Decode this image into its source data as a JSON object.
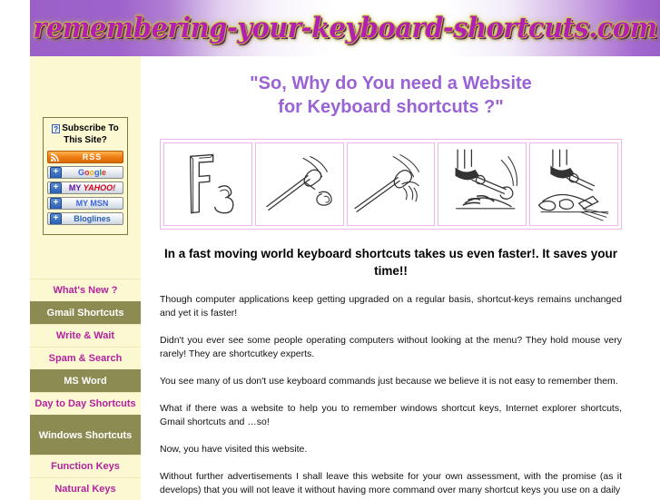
{
  "banner": {
    "title": "remembering-your-keyboard-shortcuts.com"
  },
  "sidebar": {
    "subscribe": {
      "icon": "question-mark-icon",
      "icon_glyph": "?",
      "heading_line1": "Subscribe To",
      "heading_line2": "This Site?",
      "buttons": [
        {
          "name": "rss",
          "label": "RSS",
          "icon": "rss-icon"
        },
        {
          "name": "google",
          "label": "Google",
          "icon": "plus-icon"
        },
        {
          "name": "my-yahoo",
          "label_prefix": "MY ",
          "label": "YAHOO!",
          "icon": "plus-icon"
        },
        {
          "name": "my-msn",
          "label": "MY MSN",
          "icon": "plus-icon"
        },
        {
          "name": "bloglines",
          "label": "Bloglines",
          "icon": "plus-icon"
        }
      ]
    },
    "menu": [
      {
        "label": "What's New ?",
        "highlighted": false
      },
      {
        "label": "Gmail Shortcuts",
        "highlighted": true
      },
      {
        "label": "Write & Wait",
        "highlighted": false
      },
      {
        "label": "Spam & Search",
        "highlighted": false
      },
      {
        "label": "MS Word",
        "highlighted": true
      },
      {
        "label": "Day to Day Shortcuts",
        "highlighted": false
      },
      {
        "label": "Windows Shortcuts",
        "highlighted": true
      },
      {
        "label": "Function Keys",
        "highlighted": false
      },
      {
        "label": "Natural Keys",
        "highlighted": false
      }
    ]
  },
  "main": {
    "title_line1": "\"So, Why do You need a Website",
    "title_line2": "for Keyboard shortcuts ?\"",
    "comic": {
      "alt": "cartoon of a hand smashing an F3 key with a hammer",
      "panel1_key_letter": "F",
      "panel1_key_number": "3",
      "panel_count": 5
    },
    "lead": "In a fast moving world keyboard shortcuts takes us even faster!. It saves your time!!",
    "paragraphs": [
      "Though computer applications keep getting upgraded on a regular basis, shortcut-keys remains unchanged and yet it is faster!",
      "Didn't you ever see some people operating computers without looking at the menu? They hold mouse very rarely! They are shortcutkey experts.",
      "You see many of us don't use keyboard commands just because we believe it is not easy to remember them.",
      "What if there was a website to help you to remember windows shortcut keys, Internet explorer shortcuts, Gmail shortcuts and …so!",
      "Now, you have visited this website.",
      "Without further advertisements I shall leave this website for your own assessment, with the promise (as it develops) that you will not leave it without having more command over many shortcut keys you use on a daily"
    ]
  },
  "colors": {
    "banner_purple": "#9b60c8",
    "banner_title_magenta": "#b21fb2",
    "sidebar_cream": "#fcf8d2",
    "menu_link_magenta": "#b3229e",
    "menu_highlight_olive": "#8b8b52",
    "heading_purple": "#9a63d4",
    "comic_border_pink": "#efb6ee"
  }
}
